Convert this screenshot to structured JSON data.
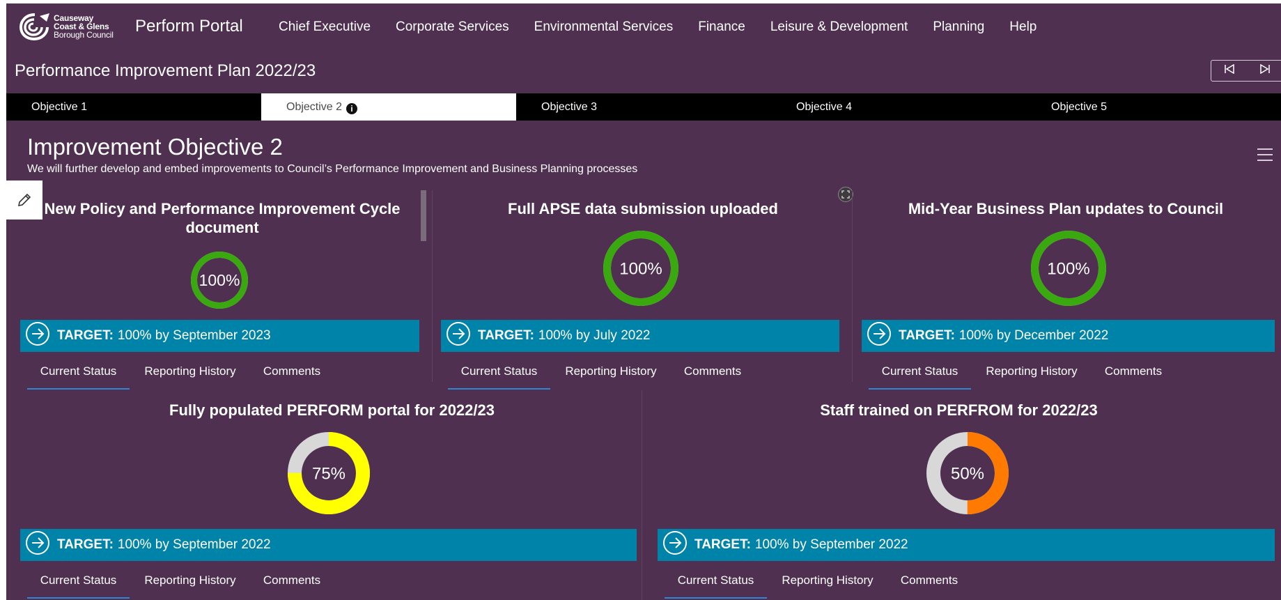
{
  "brand": {
    "logo_lines": [
      "Causeway",
      "Coast & Glens",
      "Borough Council"
    ],
    "portal_title": "Perform Portal"
  },
  "nav": [
    "Chief Executive",
    "Corporate Services",
    "Environmental Services",
    "Finance",
    "Leisure & Development",
    "Planning",
    "Help"
  ],
  "page_title": "Performance Improvement Plan 2022/23",
  "pager": {
    "prev": "⏮",
    "next": "⏭"
  },
  "tabs": [
    "Objective 1",
    "Objective 2",
    "Objective 3",
    "Objective 4",
    "Objective 5"
  ],
  "active_tab": "Objective 2",
  "objective": {
    "title": "Improvement Objective 2",
    "subtitle": "We will further develop and embed improvements to Council’s Performance Improvement and Business Planning processes"
  },
  "card_tabs": [
    "Current Status",
    "Reporting History",
    "Comments"
  ],
  "target_label": "TARGET:",
  "colors": {
    "background": "#4f3050",
    "target_bar": "#0083a8",
    "green": "#3aa90f",
    "yellow": "#ffff00",
    "orange": "#ff7a00",
    "track": "#d8d8d8"
  },
  "cards": [
    {
      "title": "New Policy and Performance Improvement Cycle document",
      "value": 100,
      "label": "100%",
      "color": "#3aa90f",
      "target": "100% by September 2023"
    },
    {
      "title": "Full APSE data submission uploaded",
      "value": 100,
      "label": "100%",
      "color": "#3aa90f",
      "target": "100% by July 2022"
    },
    {
      "title": "Mid-Year Business Plan updates to Council",
      "value": 100,
      "label": "100%",
      "color": "#3aa90f",
      "target": "100% by December 2022"
    },
    {
      "title": "Fully populated PERFORM portal for 2022/23",
      "value": 75,
      "label": "75%",
      "color": "#ffff00",
      "target": "100% by September 2022"
    },
    {
      "title": "Staff trained on PERFROM for 2022/23",
      "value": 50,
      "label": "50%",
      "color": "#ff7a00",
      "target": "100% by September 2022"
    }
  ]
}
